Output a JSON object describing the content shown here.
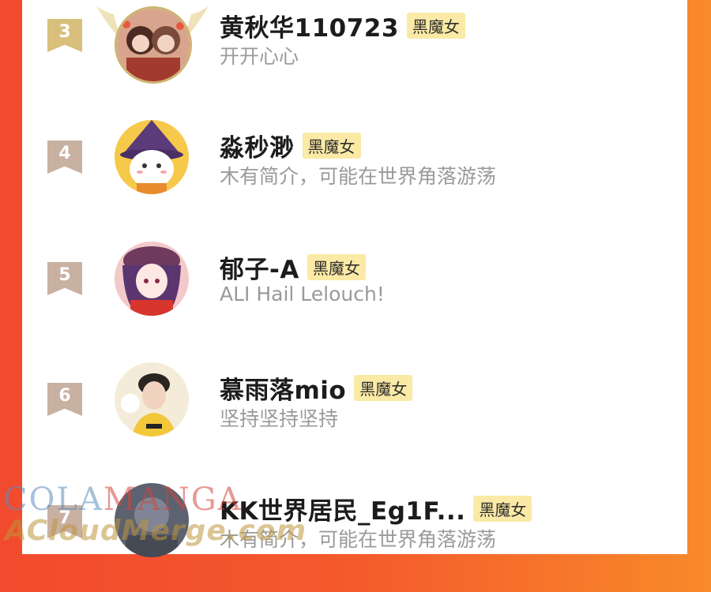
{
  "ranking": {
    "entries": [
      {
        "rank": "3",
        "name": "黄秋华110723",
        "tag": "黑魔女",
        "bio": "开开心心",
        "badge": "gold"
      },
      {
        "rank": "4",
        "name": "淼秒渺",
        "tag": "黑魔女",
        "bio": "木有简介，可能在世界角落游荡",
        "badge": "bronze"
      },
      {
        "rank": "5",
        "name": "郁子-A",
        "tag": "黑魔女",
        "bio": "ALI Hail Lelouch!",
        "badge": "bronze"
      },
      {
        "rank": "6",
        "name": "慕雨落mio",
        "tag": "黑魔女",
        "bio": "坚持坚持坚持",
        "badge": "bronze"
      },
      {
        "rank": "7",
        "name": "KK世界居民_Eg1F...",
        "tag": "黑魔女",
        "bio": "木有简介，可能在世界角落游荡",
        "badge": "bronze"
      }
    ]
  },
  "watermark": {
    "line1_a": "COLA",
    "line1_b": "MANGA",
    "line2": "ACloudMerge.com"
  },
  "colors": {
    "gold": "#d8c07c",
    "bronze": "#c9b1a2",
    "tag_bg": "#fbeaa5",
    "bg_left": "#f24a2e",
    "bg_right": "#f98a2a"
  }
}
